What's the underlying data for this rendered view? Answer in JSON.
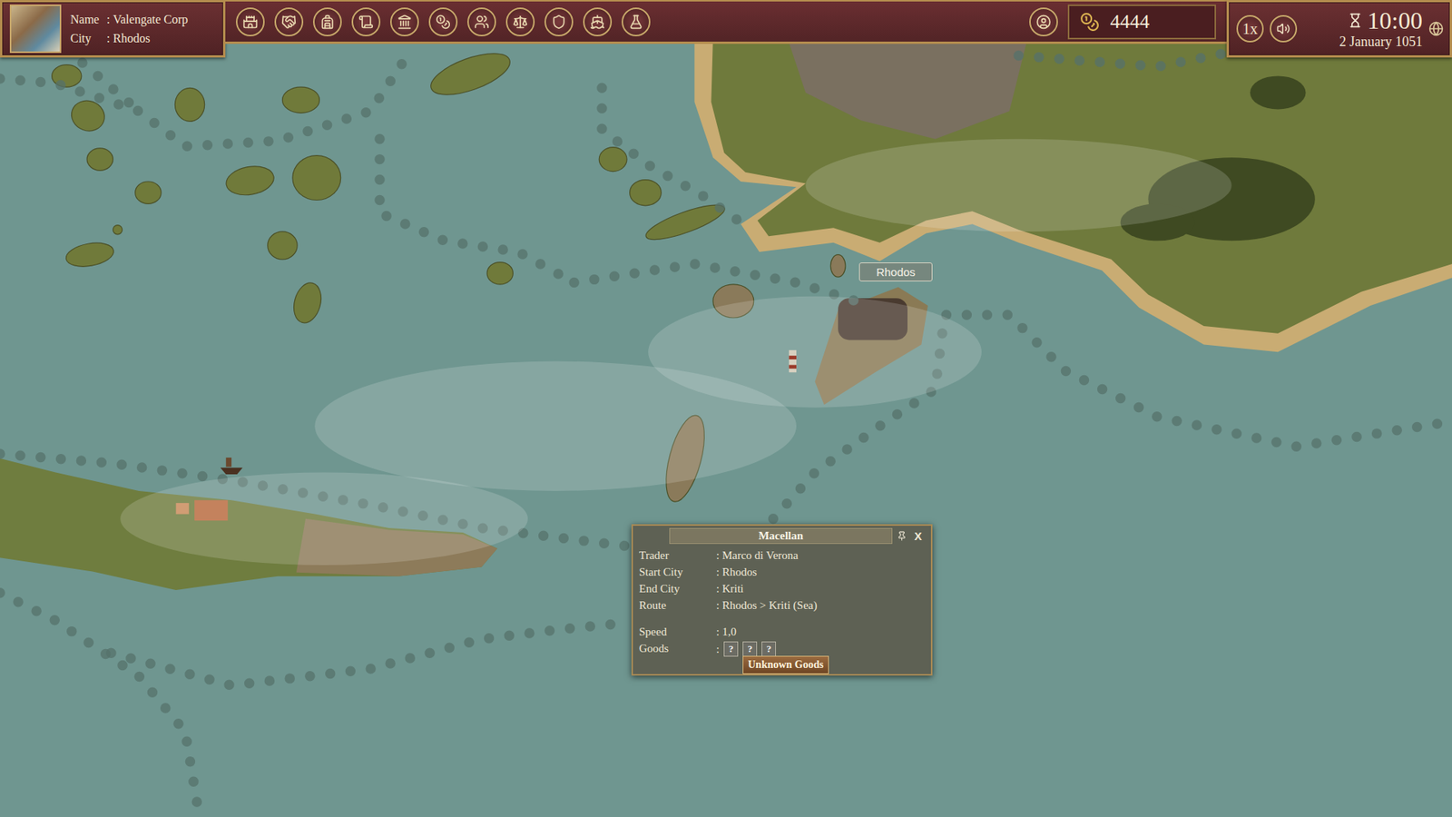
{
  "company": {
    "name_label": "Name",
    "name": "Valengate Corp",
    "city_label": "City",
    "city": "Rhodos",
    "separator": ":"
  },
  "gold": "4444",
  "speed_button": "1x",
  "time": "10:00",
  "date": "2 January 1051",
  "map_labels": [
    {
      "text": "Rhodos"
    }
  ],
  "ship_panel": {
    "title": "Macellan",
    "close": "X",
    "separator": ":",
    "rows": [
      {
        "label": "Trader",
        "value": "Marco di Verona"
      },
      {
        "label": "Start City",
        "value": "Rhodos"
      },
      {
        "label": "End City",
        "value": "Kriti"
      },
      {
        "label": "Route",
        "value": "Rhodos > Kriti (Sea)"
      }
    ],
    "stats": [
      {
        "label": "Speed",
        "value": "1,0"
      }
    ],
    "goods": {
      "label": "Goods",
      "slots": [
        "?",
        "?",
        "?"
      ]
    },
    "tooltip": "Unknown Goods"
  }
}
